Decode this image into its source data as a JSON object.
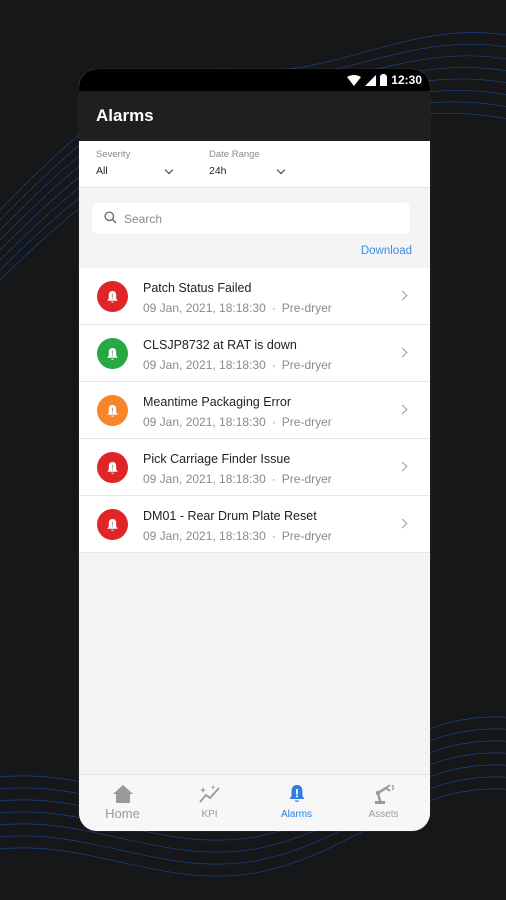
{
  "statusbar": {
    "time": "12:30"
  },
  "header": {
    "title": "Alarms"
  },
  "filters": {
    "severity": {
      "label": "Severity",
      "value": "All"
    },
    "date_range": {
      "label": "Date Range",
      "value": "24h"
    }
  },
  "search": {
    "placeholder": "Search"
  },
  "download_label": "Download",
  "alarms": [
    {
      "title": "Patch Status Failed",
      "time": "09 Jan, 2021, 18:18:30",
      "sep": "·",
      "location": "Pre-dryer",
      "color": "#e02528"
    },
    {
      "title": "CLSJP8732 at RAT is down",
      "time": "09 Jan, 2021, 18:18:30",
      "sep": "·",
      "location": "Pre-dryer",
      "color": "#28a745"
    },
    {
      "title": "Meantime Packaging Error",
      "time": "09 Jan, 2021, 18:18:30",
      "sep": "·",
      "location": "Pre-dryer",
      "color": "#f7862b"
    },
    {
      "title": "Pick Carriage Finder Issue",
      "time": "09 Jan, 2021, 18:18:30",
      "sep": "·",
      "location": "Pre-dryer",
      "color": "#e02528"
    },
    {
      "title": "DM01 - Rear Drum Plate Reset",
      "time": "09 Jan, 2021, 18:18:30",
      "sep": "·",
      "location": "Pre-dryer",
      "color": "#e02528"
    }
  ],
  "nav": [
    {
      "label": "Home",
      "icon": "home-icon",
      "active": false
    },
    {
      "label": "KPI",
      "icon": "kpi-icon",
      "active": false
    },
    {
      "label": "Alarms",
      "icon": "bell-icon",
      "active": true
    },
    {
      "label": "Assets",
      "icon": "robot-arm-icon",
      "active": false
    }
  ],
  "colors": {
    "accent": "#2f7de1",
    "link": "#3b8ee6",
    "appbar": "#1f1f1f"
  }
}
